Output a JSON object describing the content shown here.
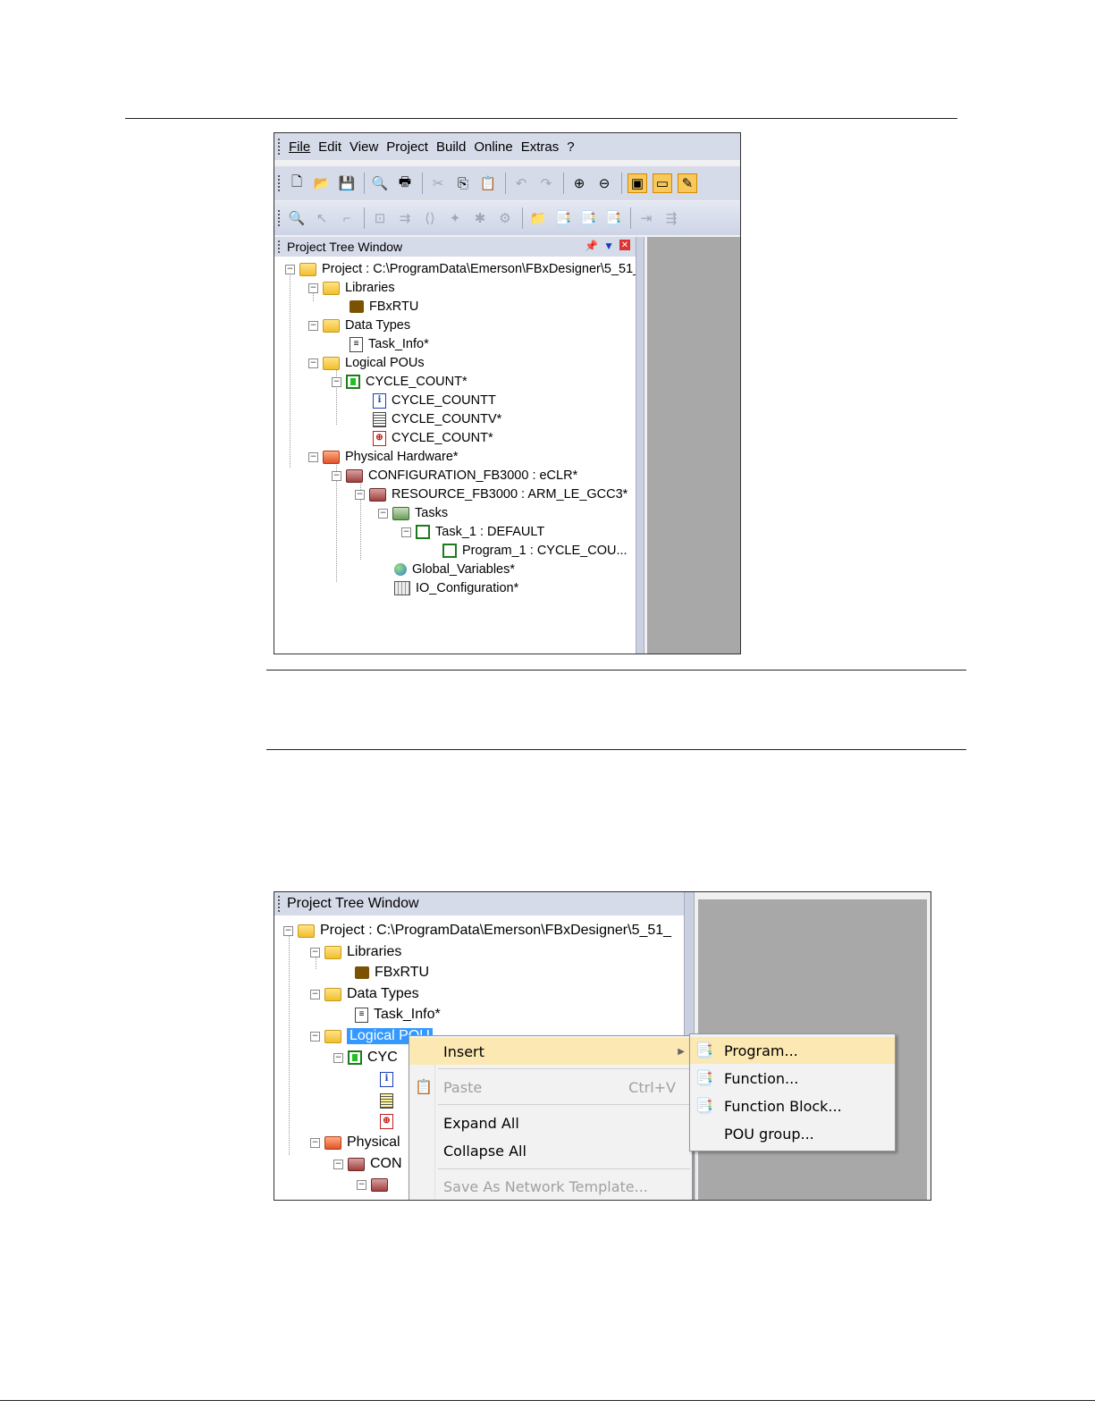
{
  "menu": [
    "File",
    "Edit",
    "View",
    "Project",
    "Build",
    "Online",
    "Extras",
    "?"
  ],
  "panel_title": "Project Tree Window",
  "tree": {
    "project": "Project : C:\\ProgramData\\Emerson\\FBxDesigner\\5_51_",
    "libraries": "Libraries",
    "fbxrtu": "FBxRTU",
    "data_types": "Data Types",
    "task_info": "Task_Info*",
    "logical_pous": "Logical POUs",
    "cycle_count": "CYCLE_COUNT*",
    "cycle_countt": "CYCLE_COUNTT",
    "cycle_countv": "CYCLE_COUNTV*",
    "cycle_count_code": "CYCLE_COUNT*",
    "physical_hw": "Physical Hardware*",
    "configuration": "CONFIGURATION_FB3000 : eCLR*",
    "resource": "RESOURCE_FB3000 : ARM_LE_GCC3*",
    "tasks": "Tasks",
    "task1": "Task_1 : DEFAULT",
    "program1": "Program_1 : CYCLE_COU...",
    "globals": "Global_Variables*",
    "io_config": "IO_Configuration*"
  },
  "tree2": {
    "logical_partial": "Logical POU",
    "cyc_partial": "CYC",
    "physical_partial": "Physical",
    "con_partial": "CON"
  },
  "context_menu": {
    "insert": "Insert",
    "paste": "Paste",
    "paste_shortcut": "Ctrl+V",
    "expand_all": "Expand All",
    "collapse_all": "Collapse All",
    "save_as_template": "Save As Network Template..."
  },
  "submenu": {
    "program": "Program...",
    "function": "Function...",
    "function_block": "Function Block...",
    "pou_group": "POU group..."
  }
}
